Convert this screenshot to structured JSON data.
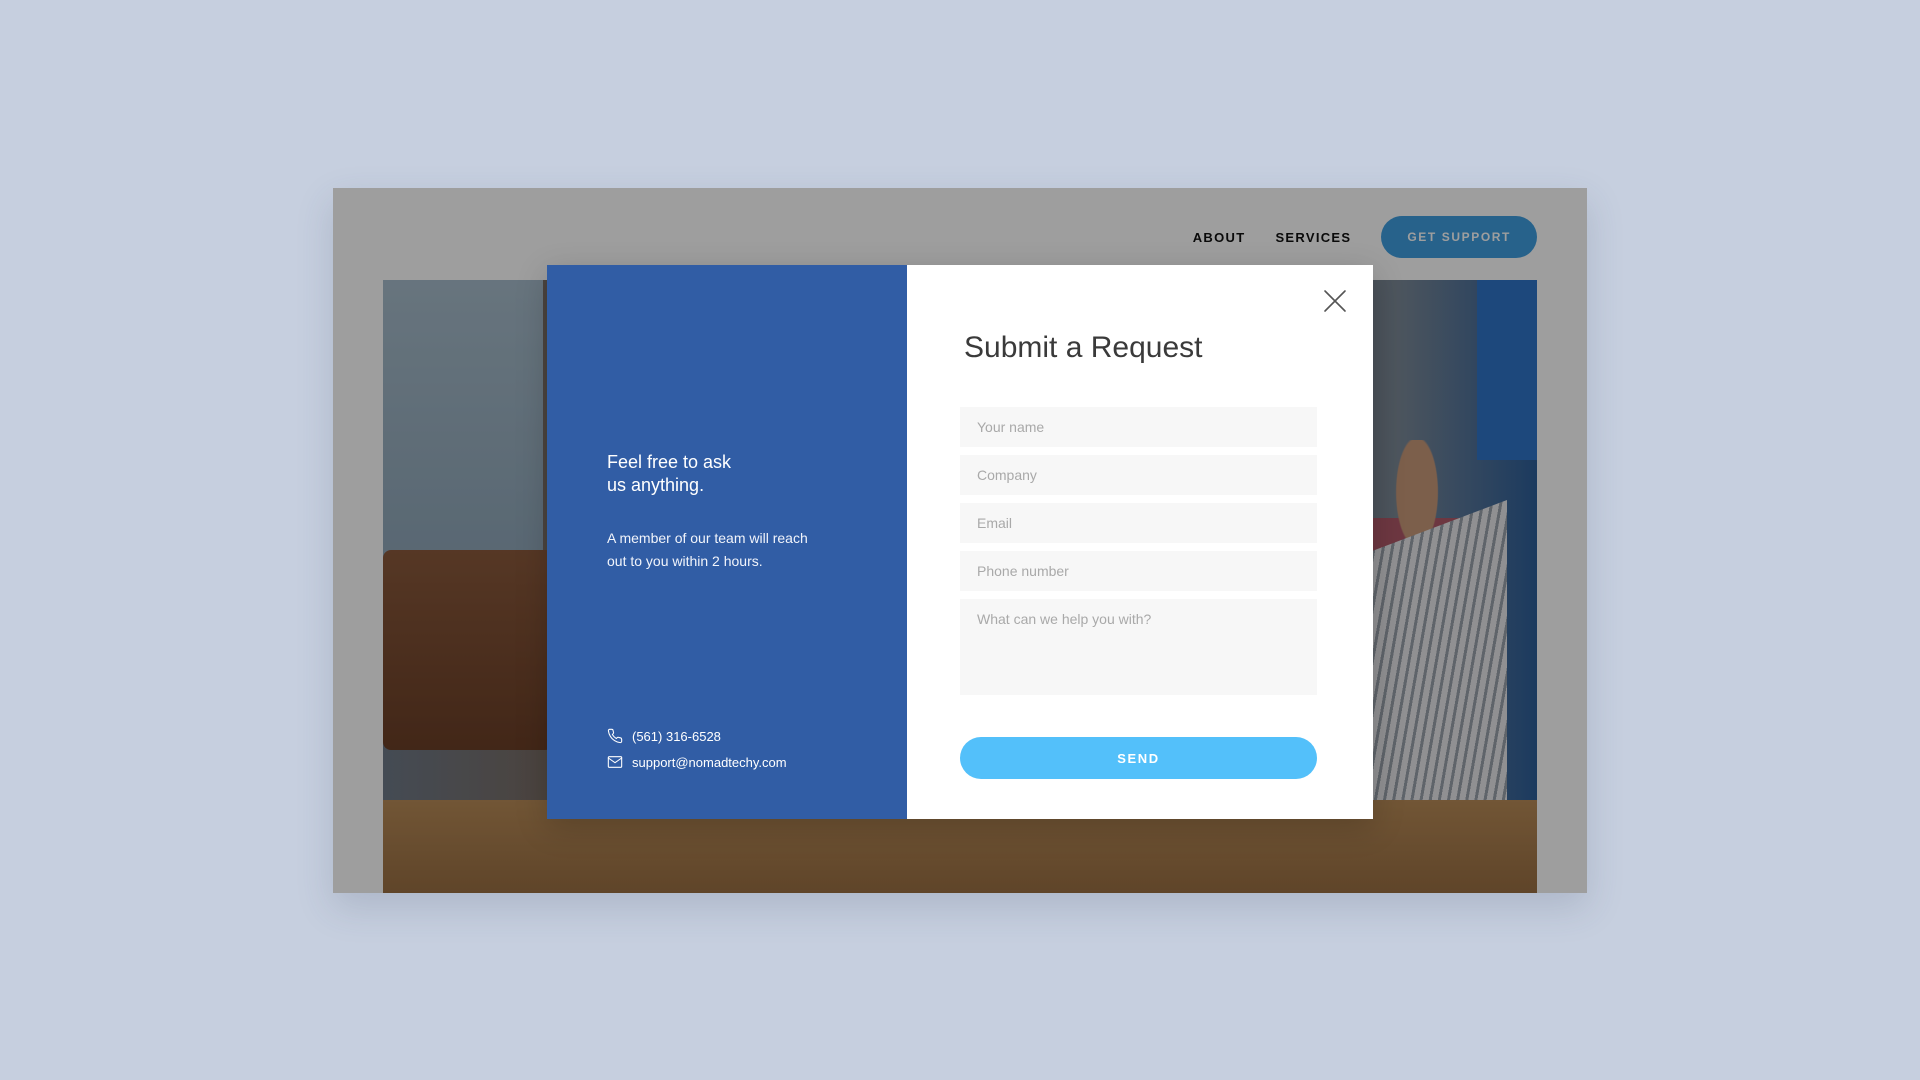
{
  "nav": {
    "about_label": "ABOUT",
    "services_label": "SERVICES",
    "get_support_label": "GET SUPPORT"
  },
  "modal": {
    "left": {
      "heading_line1": "Feel free to ask",
      "heading_line2": "us anything.",
      "sub_line1": "A member of our team will reach",
      "sub_line2": "out to you within 2 hours.",
      "phone": "(561) 316-6528",
      "email": "support@nomadtechy.com"
    },
    "right": {
      "title": "Submit a Request",
      "fields": {
        "name_placeholder": "Your name",
        "company_placeholder": "Company",
        "email_placeholder": "Email",
        "phone_placeholder": "Phone number",
        "message_placeholder": "What can we help you with?"
      },
      "send_label": "SEND"
    }
  },
  "colors": {
    "page_background": "#c6cfdf",
    "modal_left_background": "#315da5",
    "send_button": "#53c0fa",
    "nav_button": "#3f9fe0"
  },
  "icons": {
    "phone": "phone-icon",
    "email": "envelope-icon",
    "close": "close-icon"
  }
}
